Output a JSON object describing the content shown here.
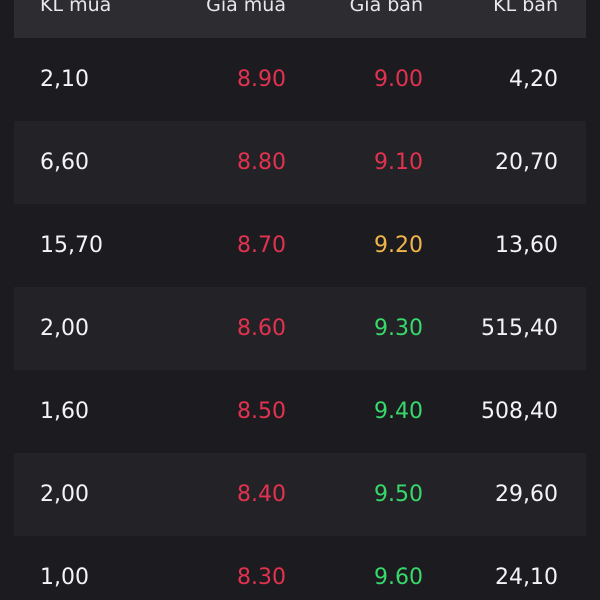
{
  "header": {
    "buy_volume": "KL mua",
    "buy_price": "Giá mua",
    "sell_price": "Giá bán",
    "sell_volume": "KL bán"
  },
  "colors": {
    "background": "#1c1c20",
    "row_alt": "#232327",
    "header_bg": "#2c2c31",
    "red": "#e2324f",
    "yellow": "#f1b54a",
    "green": "#37d96a",
    "white": "#f4f4f6"
  },
  "rows": [
    {
      "buy_volume": "2,10",
      "buy_price": "8.90",
      "sell_price": "9.00",
      "sell_price_color": "red",
      "sell_volume": "4,20"
    },
    {
      "buy_volume": "6,60",
      "buy_price": "8.80",
      "sell_price": "9.10",
      "sell_price_color": "red",
      "sell_volume": "20,70"
    },
    {
      "buy_volume": "15,70",
      "buy_price": "8.70",
      "sell_price": "9.20",
      "sell_price_color": "yellow",
      "sell_volume": "13,60"
    },
    {
      "buy_volume": "2,00",
      "buy_price": "8.60",
      "sell_price": "9.30",
      "sell_price_color": "green",
      "sell_volume": "515,40"
    },
    {
      "buy_volume": "1,60",
      "buy_price": "8.50",
      "sell_price": "9.40",
      "sell_price_color": "green",
      "sell_volume": "508,40"
    },
    {
      "buy_volume": "2,00",
      "buy_price": "8.40",
      "sell_price": "9.50",
      "sell_price_color": "green",
      "sell_volume": "29,60"
    },
    {
      "buy_volume": "1,00",
      "buy_price": "8.30",
      "sell_price": "9.60",
      "sell_price_color": "green",
      "sell_volume": "24,10"
    }
  ]
}
